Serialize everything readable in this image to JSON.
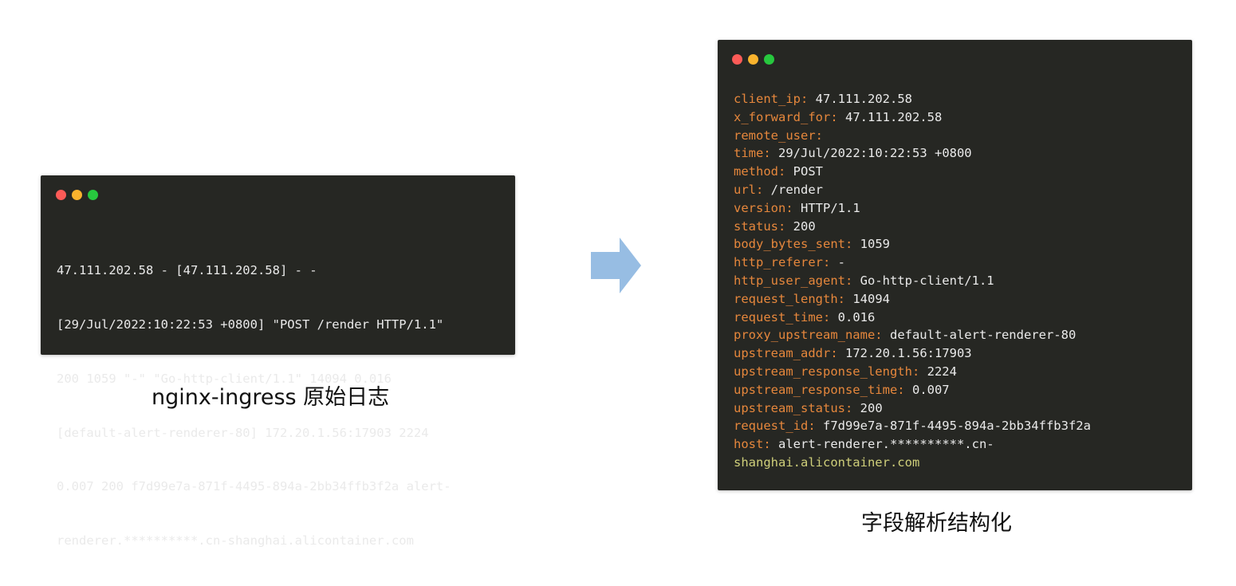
{
  "colors": {
    "terminal_bg": "#262723",
    "dot_red": "#fc5b57",
    "dot_yellow": "#f9b32d",
    "dot_green": "#27c83e",
    "key": "#e6873c",
    "value": "#eaeaea",
    "arrow": "#97bde3"
  },
  "raw": {
    "lines": [
      "47.111.202.58 - [47.111.202.58] - -",
      "[29/Jul/2022:10:22:53 +0800] \"POST /render HTTP/1.1\"",
      "200 1059 \"-\" \"Go-http-client/1.1\" 14094 0.016",
      "[default-alert-renderer-80] 172.20.1.56:17903 2224",
      "0.007 200 f7d99e7a-871f-4495-894a-2bb34ffb3f2a alert-",
      "renderer.**********.cn-shanghai.alicontainer.com"
    ],
    "caption": "nginx-ingress 原始日志"
  },
  "parsed": {
    "fields": [
      {
        "key": "client_ip:",
        "value": "47.111.202.58"
      },
      {
        "key": "x_forward_for:",
        "value": "47.111.202.58"
      },
      {
        "key": "remote_user:",
        "value": ""
      },
      {
        "key": "time:",
        "value": "29/Jul/2022:10:22:53 +0800"
      },
      {
        "key": "method:",
        "value": "POST"
      },
      {
        "key": "url:",
        "value": "/render"
      },
      {
        "key": "version:",
        "value": "HTTP/1.1"
      },
      {
        "key": "status:",
        "value": "200"
      },
      {
        "key": "body_bytes_sent:",
        "value": "1059"
      },
      {
        "key": "http_referer:",
        "value": "-"
      },
      {
        "key": "http_user_agent:",
        "value": "Go-http-client/1.1"
      },
      {
        "key": "request_length:",
        "value": "14094"
      },
      {
        "key": "request_time:",
        "value": "0.016"
      },
      {
        "key": "proxy_upstream_name:",
        "value": "default-alert-renderer-80"
      },
      {
        "key": "upstream_addr:",
        "value": "172.20.1.56:17903"
      },
      {
        "key": "upstream_response_length:",
        "value": "2224"
      },
      {
        "key": "upstream_response_time:",
        "value": "0.007"
      },
      {
        "key": "upstream_status:",
        "value": "200"
      },
      {
        "key": "request_id:",
        "value": "f7d99e7a-871f-4495-894a-2bb34ffb3f2a"
      },
      {
        "key": "host:",
        "value": "alert-renderer.**********.cn-"
      }
    ],
    "host_continuation": "shanghai.alicontainer.com",
    "caption": "字段解析结构化"
  }
}
